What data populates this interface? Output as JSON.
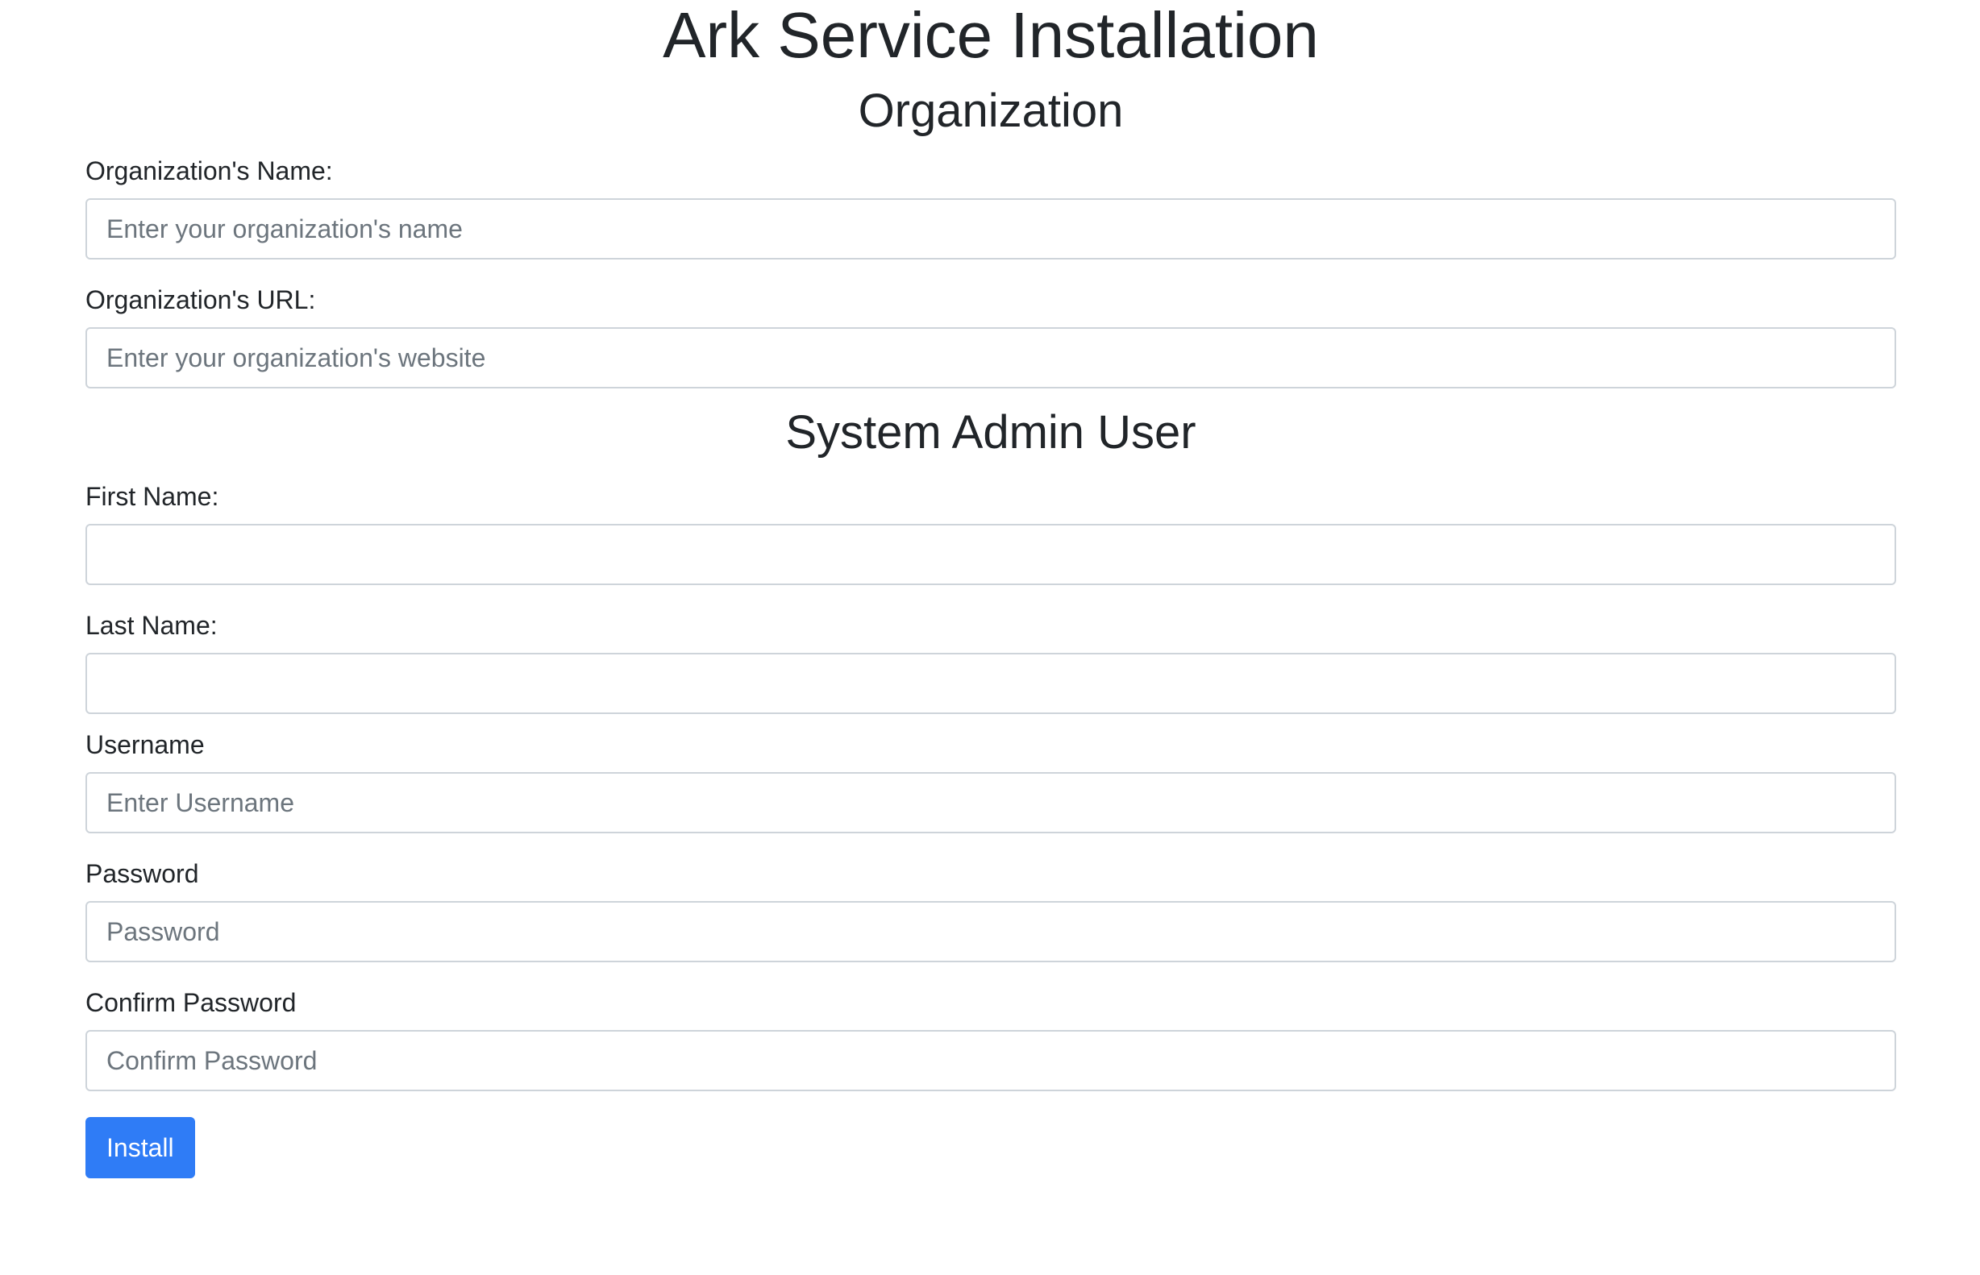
{
  "page": {
    "title": "Ark Service Installation"
  },
  "organization": {
    "heading": "Organization",
    "name_label": "Organization's Name:",
    "name_placeholder": "Enter your organization's name",
    "name_value": "",
    "url_label": "Organization's URL:",
    "url_placeholder": "Enter your organization's website",
    "url_value": ""
  },
  "admin": {
    "heading": "System Admin User",
    "first_name_label": "First Name:",
    "first_name_placeholder": "",
    "first_name_value": "",
    "last_name_label": "Last Name:",
    "last_name_placeholder": "",
    "last_name_value": "",
    "username_label": "Username",
    "username_placeholder": "Enter Username",
    "username_value": "",
    "password_label": "Password",
    "password_placeholder": "Password",
    "password_value": "",
    "confirm_password_label": "Confirm Password",
    "confirm_password_placeholder": "Confirm Password",
    "confirm_password_value": ""
  },
  "actions": {
    "install_label": "Install"
  },
  "colors": {
    "primary": "#2f7cf6",
    "text": "#212529",
    "placeholder": "#6c757d",
    "input_border": "#ced4da",
    "background": "#ffffff"
  }
}
